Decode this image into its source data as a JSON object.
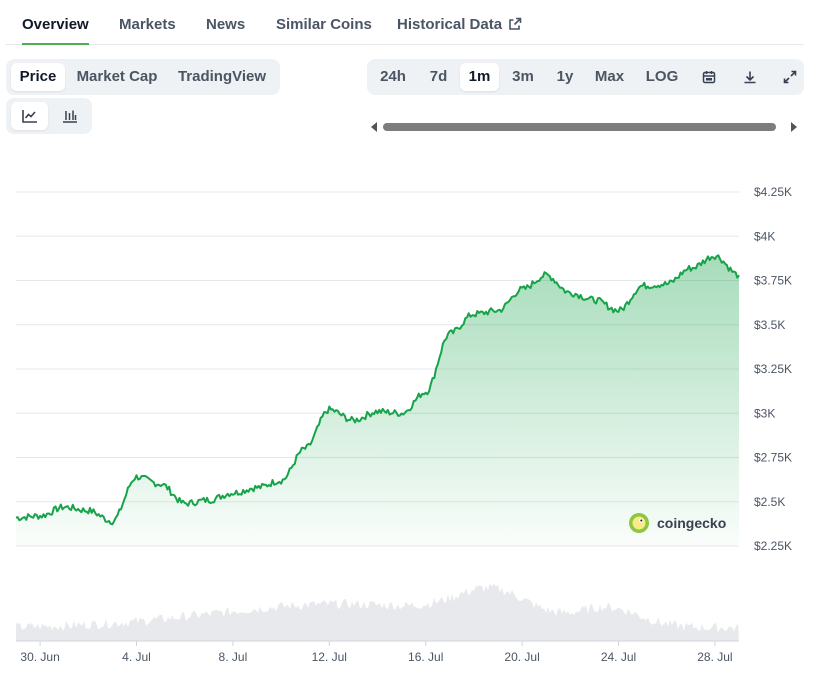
{
  "tabs": [
    {
      "label": "Overview",
      "active": true
    },
    {
      "label": "Markets"
    },
    {
      "label": "News"
    },
    {
      "label": "Similar Coins"
    },
    {
      "label": "Historical Data"
    }
  ],
  "chart_types": [
    {
      "label": "Price",
      "active": true
    },
    {
      "label": "Market Cap"
    },
    {
      "label": "TradingView"
    }
  ],
  "view_icons": [
    {
      "icon": "line-chart-icon",
      "active": true
    },
    {
      "icon": "candlestick-chart-icon"
    }
  ],
  "ranges": [
    {
      "label": "24h"
    },
    {
      "label": "7d"
    },
    {
      "label": "1m",
      "active": true
    },
    {
      "label": "3m"
    },
    {
      "label": "1y"
    },
    {
      "label": "Max"
    },
    {
      "label": "LOG"
    }
  ],
  "range_icons": [
    "calendar-icon",
    "download-icon",
    "expand-icon"
  ],
  "brand": {
    "name": "coingecko"
  },
  "colors": {
    "line": "#16a34a",
    "volume": "#e5e7eb",
    "accent": "#4caf50"
  },
  "chart_data": {
    "type": "line",
    "title": "",
    "xlabel": "",
    "ylabel": "",
    "x_ticks": [
      "30. Jun",
      "4. Jul",
      "8. Jul",
      "12. Jul",
      "16. Jul",
      "20. Jul",
      "24. Jul",
      "28. Jul"
    ],
    "y_ticks": [
      "$2.25K",
      "$2.5K",
      "$2.75K",
      "$3K",
      "$3.25K",
      "$3.5K",
      "$3.75K",
      "$4K",
      "$4.25K"
    ],
    "ylim": [
      2250,
      4250
    ],
    "xlim": [
      "2025-06-29",
      "2025-07-29"
    ],
    "grid": true,
    "series": [
      {
        "values": [
          [
            "2025-06-29",
            2410
          ],
          [
            "2025-06-30",
            2420
          ],
          [
            "2025-07-01",
            2470
          ],
          [
            "2025-07-02",
            2450
          ],
          [
            "2025-07-03",
            2390
          ],
          [
            "2025-07-04",
            2640
          ],
          [
            "2025-07-05",
            2600
          ],
          [
            "2025-07-06",
            2490
          ],
          [
            "2025-07-07",
            2510
          ],
          [
            "2025-07-08",
            2550
          ],
          [
            "2025-07-09",
            2580
          ],
          [
            "2025-07-10",
            2620
          ],
          [
            "2025-07-11",
            2800
          ],
          [
            "2025-07-12",
            3020
          ],
          [
            "2025-07-13",
            2960
          ],
          [
            "2025-07-14",
            3010
          ],
          [
            "2025-07-15",
            3000
          ],
          [
            "2025-07-16",
            3120
          ],
          [
            "2025-07-17",
            3450
          ],
          [
            "2025-07-18",
            3560
          ],
          [
            "2025-07-19",
            3580
          ],
          [
            "2025-07-20",
            3700
          ],
          [
            "2025-07-21",
            3780
          ],
          [
            "2025-07-22",
            3680
          ],
          [
            "2025-07-23",
            3640
          ],
          [
            "2025-07-24",
            3580
          ],
          [
            "2025-07-25",
            3720
          ],
          [
            "2025-07-26",
            3730
          ],
          [
            "2025-07-27",
            3820
          ],
          [
            "2025-07-28",
            3890
          ],
          [
            "2025-07-29",
            3780
          ]
        ]
      }
    ]
  }
}
